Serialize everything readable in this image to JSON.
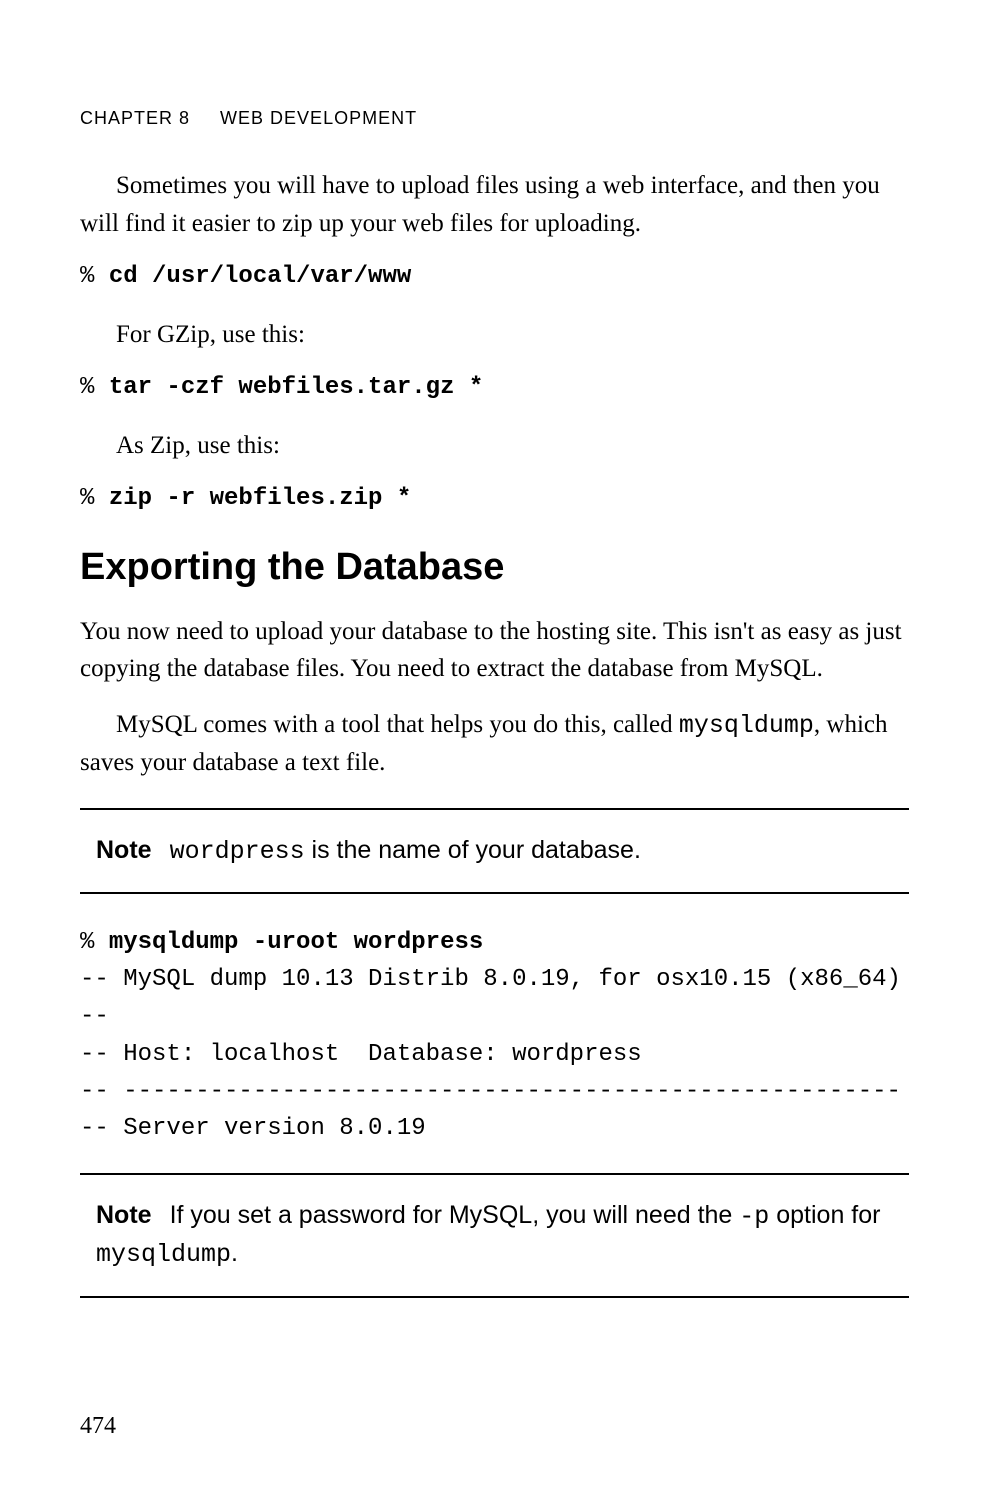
{
  "header": {
    "chapter": "CHAPTER 8",
    "title": "WEB DEVELOPMENT"
  },
  "paragraphs": {
    "p1": "Sometimes you will have to upload files using a web interface, and then you will find it easier to zip up your web files for uploading.",
    "p2": "For GZip, use this:",
    "p3": "As Zip, use this:",
    "p4": "You now need to upload your database to the hosting site. This isn't as easy as just copying the database files. You need to extract the database from MySQL.",
    "p5a": "MySQL comes with a tool that helps you do this, called ",
    "p5b": "mysqldump",
    "p5c": ", which saves your database a text file."
  },
  "commands": {
    "prompt": "% ",
    "cmd1": "cd /usr/local/var/www",
    "cmd2": "tar -czf webfiles.tar.gz *",
    "cmd3": "zip -r webfiles.zip *",
    "cmd4": "mysqldump -uroot wordpress"
  },
  "section": {
    "heading": "Exporting the Database"
  },
  "note1": {
    "label": "Note",
    "mono": "wordpress",
    "rest": " is the name of your database."
  },
  "dump": {
    "line1": "-- MySQL dump 10.13 Distrib 8.0.19, for osx10.15 (x86_64)",
    "line2": "--",
    "line3": "-- Host: localhost  Database: wordpress",
    "line4": "-- ------------------------------------------------------",
    "line5": "-- Server version 8.0.19"
  },
  "note2": {
    "label": "Note",
    "t1": "If you set a password for MySQL, you will need the ",
    "mono1": "-p",
    "t2": " option for ",
    "mono2": "mysqldump",
    "t3": "."
  },
  "pagenum": "474"
}
